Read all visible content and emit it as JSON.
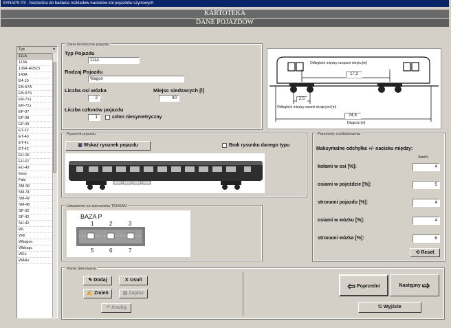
{
  "window": {
    "title": "SYNAPS P3 - Narzedzia do badania rozkladow nacisków kół pojazdów szynowych"
  },
  "banner": {
    "line1": "KARTOTEKA",
    "line2": "DANE POJAZDÓW"
  },
  "list": {
    "header": "Typ",
    "items": [
      "111A",
      "113A",
      "136A-H0523",
      "143A",
      "E4-10",
      "EN-57A",
      "EN-57S",
      "EN-71s",
      "EN-71s",
      "EP-07",
      "EP-08",
      "EP-09",
      "ET-22",
      "ET-40",
      "ET-41",
      "ET-42",
      "EU-06",
      "EU-07",
      "EU-43",
      "Esss",
      "Fals",
      "SM-30",
      "SM-31",
      "SM-42",
      "SM-48",
      "SP-32",
      "SP-42",
      "SU-42",
      "WL",
      "Wdl",
      "Wbagon",
      "Wbhagc",
      "WEx",
      "WAAn"
    ],
    "selected_index": 0
  },
  "tech": {
    "group_title": "Dane techniczne pojazdu",
    "typ_label": "Typ Pojazdu",
    "typ_value": "111A",
    "rodzaj_label": "Rodzaj Pojazdu",
    "rodzaj_value": "Wagon",
    "osi_label": "Liczba osi wózka",
    "osi_value": "2",
    "miejsca_label": "Miejsc siedzacych [l]",
    "miejsca_value": "40",
    "czlonow_label": "Liczba członów pojazdu",
    "czlonow_value": "1",
    "niesym_label": "człon niesymetryczny"
  },
  "diagram": {
    "top_label": "Odległość między czopami skrętu [m]",
    "top_value": "17,2",
    "axle_value": "2,5",
    "bottom_label": "Odległość między osiami skrajnymi [m]",
    "bottom_value": "24,5",
    "length_label": "Długość [m]"
  },
  "drawing": {
    "group_title": "Rysunek pojazdu",
    "show_button": "Wskaż rysunek pojazdu",
    "no_drawing_label": "Brak rysunku danego typu"
  },
  "sensors": {
    "group_title": "Ustawienie na stanowisku TENSAN",
    "base_label": "BAZA P",
    "top_numbers": [
      "1",
      "2",
      "3"
    ],
    "bottom_numbers": [
      "5",
      "6",
      "7"
    ]
  },
  "params": {
    "group_title": "Parametry rozkładowania",
    "heading": "Maksymalne odchyłka +/- nacisku między:",
    "column_label": "Stan%",
    "rows": [
      {
        "label": "kołami w osi [%]:",
        "value": "4"
      },
      {
        "label": "osiami w pojeździe [%]:",
        "value": "5"
      },
      {
        "label": "stronami pojazdu [%]:",
        "value": "4"
      },
      {
        "label": "osiami w wózku [%]:",
        "value": "4"
      },
      {
        "label": "stronami wózka [%]:",
        "value": "6"
      }
    ],
    "reset_label": "Reset"
  },
  "panel": {
    "group_title": "Panel Sterowania",
    "dodaj": "Dodaj",
    "usun": "Usuń",
    "zmien": "Zmień",
    "zapisz": "Zapisz",
    "anuluj": "Anuluj"
  },
  "nav": {
    "prev": "Poprzedni",
    "next": "Następny",
    "exit": "Wyjście"
  }
}
